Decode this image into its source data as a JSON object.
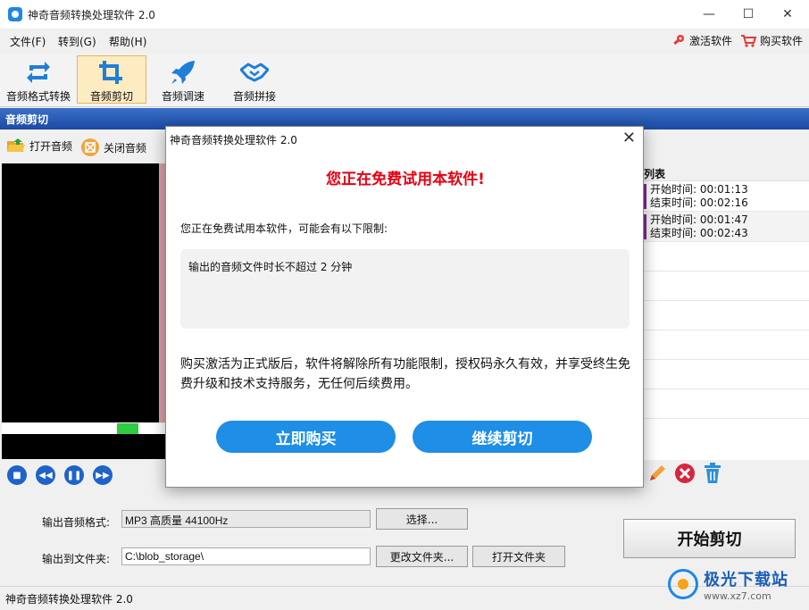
{
  "window": {
    "title": "神奇音频转换处理软件 2.0",
    "min": "—",
    "max": "☐",
    "close": "✕"
  },
  "menu": {
    "items": [
      "文件(F)",
      "转到(G)",
      "帮助(H)"
    ],
    "activate": "激活软件",
    "buy": "购买软件"
  },
  "toolbar": {
    "tools": [
      "音频格式转换",
      "音频剪切",
      "音频调速",
      "音频拼接"
    ],
    "active_index": 1
  },
  "section": {
    "title": "音频剪切"
  },
  "subtools": {
    "open": "打开音频",
    "close": "关闭音频"
  },
  "list": {
    "header": "列表",
    "rows": [
      {
        "start": "开始时间:  00:01:13",
        "end": "结束时间:  00:02:16"
      },
      {
        "start": "开始时间:  00:01:47",
        "end": "结束时间:  00:02:43"
      }
    ]
  },
  "output": {
    "format_label": "输出音频格式:",
    "format_value": "MP3 高质量 44100Hz",
    "select_button": "选择...",
    "folder_label": "输出到文件夹:",
    "folder_value": "C:\\blob_storage\\",
    "change_folder_button": "更改文件夹...",
    "open_folder_button": "打开文件夹",
    "start_button": "开始剪切"
  },
  "status": {
    "text": "神奇音频转换处理软件 2.0"
  },
  "watermark": {
    "main": "极光下载站",
    "sub": "www.xz7.com"
  },
  "dialog": {
    "title": "神奇音频转换处理软件 2.0",
    "close": "✕",
    "headline": "您正在免费试用本软件!",
    "intro": "您正在免费试用本软件，可能会有以下限制:",
    "limit": "输出的音频文件时长不超过 2 分钟",
    "description": "购买激活为正式版后，软件将解除所有功能限制，授权码永久有效，并享受终生免费升级和技术支持服务，无任何后续费用。",
    "buy_button": "立即购买",
    "continue_button": "继续剪切"
  },
  "colors": {
    "accent_blue": "#1e8ee6",
    "warning_red": "#e60012",
    "section_blue": "#1b4aa3",
    "active_tool": "#fdebc2"
  }
}
